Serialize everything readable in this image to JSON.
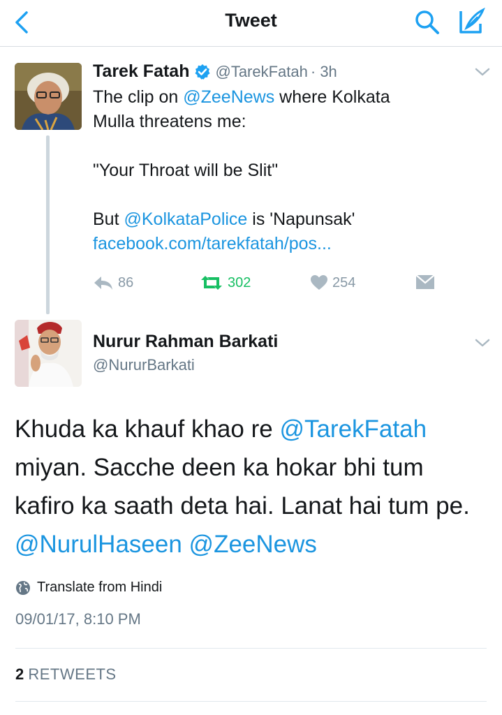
{
  "nav": {
    "title": "Tweet",
    "icons": {
      "back": "chevron-left-icon",
      "search": "search-icon",
      "compose": "compose-icon"
    }
  },
  "colors": {
    "link": "#1b95e0",
    "retweet": "#17bf63",
    "verified": "#1da1f2",
    "muted": "#8899a6"
  },
  "parent_tweet": {
    "author_name": "Tarek Fatah",
    "handle": "@TarekFatah",
    "time": "· 3h",
    "verified": true,
    "line1_pre": "The clip on ",
    "line1_mention": "@ZeeNews",
    "line1_post": " where Kolkata",
    "line2": "Mulla threatens me:",
    "line3": "\"Your Throat will be Slit\"",
    "line4_pre": "But ",
    "line4_mention": "@KolkataPolice",
    "line4_post": " is 'Napunsak'",
    "link": "facebook.com/tarekfatah/pos...",
    "replies": "86",
    "retweets": "302",
    "likes": "254"
  },
  "reply_tweet": {
    "author_name": "Nurur Rahman Barkati",
    "handle": "@NururBarkati",
    "line1_pre": "Khuda ka khauf khao re ",
    "line1_mention": "@TarekFatah",
    "line2": "miyan. Sacche deen ka hokar bhi tum",
    "line3": "kafiro ka saath deta hai. Lanat hai tum pe.",
    "line4_mention1": "@NurulHaseen",
    "line4_mention2": "@ZeeNews",
    "translate_label": "Translate from Hindi",
    "timestamp": "09/01/17, 8:10 PM",
    "retweet_count": "2",
    "retweet_label": "RETWEETS"
  }
}
